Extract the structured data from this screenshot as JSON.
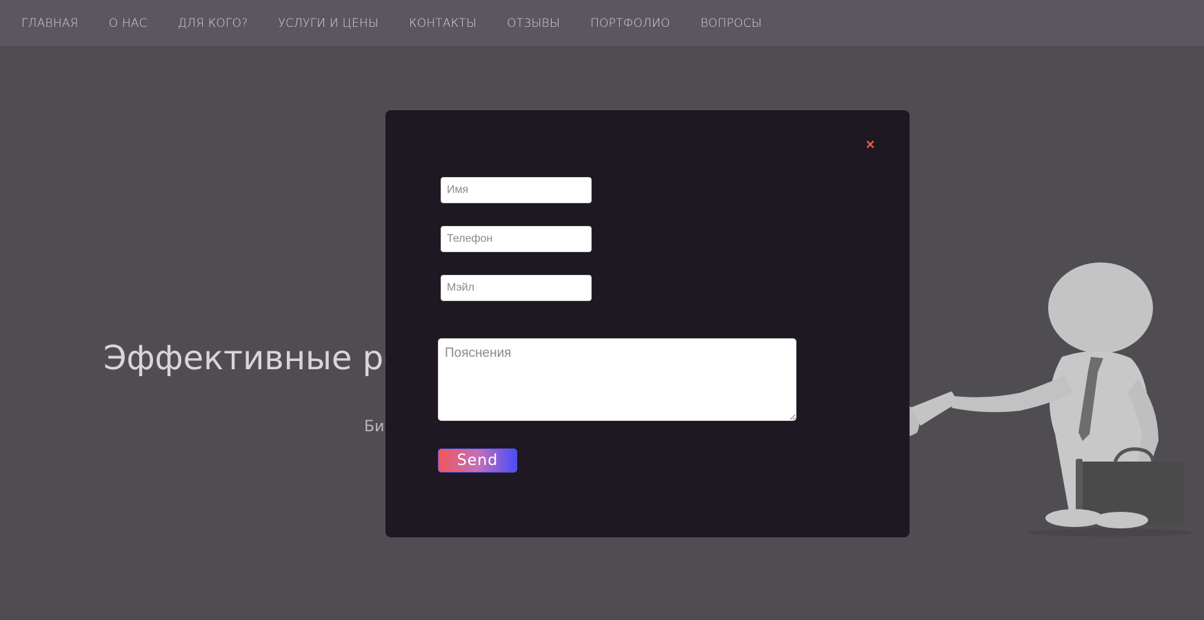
{
  "nav": {
    "items": [
      {
        "label": "ГЛАВНАЯ"
      },
      {
        "label": "О НАС"
      },
      {
        "label": "ДЛЯ КОГО?"
      },
      {
        "label": "УСЛУГИ И ЦЕНЫ"
      },
      {
        "label": "КОНТАКТЫ"
      },
      {
        "label": "ОТЗЫВЫ"
      },
      {
        "label": "ПОРТФОЛИО"
      },
      {
        "label": "ВОПРОСЫ"
      }
    ]
  },
  "hero": {
    "title_visible": "Эффективные реш",
    "subtitle_visible": "Би"
  },
  "modal": {
    "close_label": "×",
    "name_placeholder": "Имя",
    "phone_placeholder": "Телефон",
    "email_placeholder": "Мэйл",
    "notes_placeholder": "Пояснения",
    "send_label": "Send"
  },
  "colors": {
    "accent_close": "#ef5a3c",
    "modal_bg": "#1e1822",
    "button_gradient_start": "#f0575a",
    "button_gradient_end": "#4a4df6"
  }
}
